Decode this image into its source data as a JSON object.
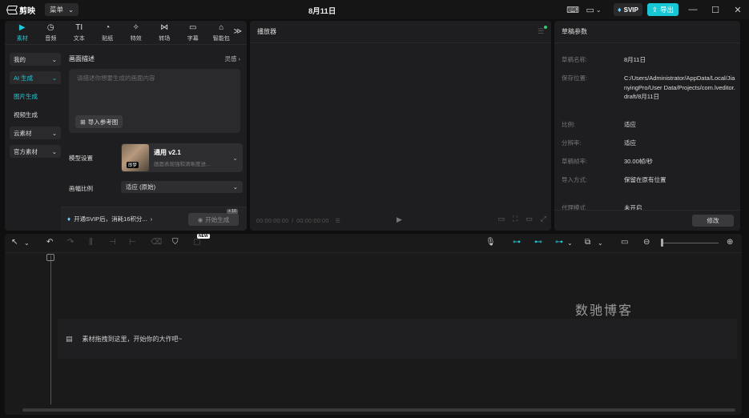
{
  "app": {
    "name": "剪映",
    "menu_label": "菜单",
    "title": "8月11日",
    "svip_label": "SVIP",
    "export_label": "导出"
  },
  "tool_tabs": [
    {
      "label": "素材",
      "icon": "media-icon",
      "active": true
    },
    {
      "label": "音频",
      "icon": "audio-icon"
    },
    {
      "label": "文本",
      "icon": "text-icon"
    },
    {
      "label": "贴纸",
      "icon": "sticker-icon"
    },
    {
      "label": "特效",
      "icon": "effects-icon"
    },
    {
      "label": "转场",
      "icon": "transition-icon"
    },
    {
      "label": "字幕",
      "icon": "subtitle-icon"
    },
    {
      "label": "智能包",
      "icon": "smart-pack-icon"
    }
  ],
  "categories": {
    "mine": "我的",
    "ai_gen": "AI 生成",
    "image_gen": "图片生成",
    "video_gen": "视频生成",
    "cloud": "云素材",
    "official": "官方素材"
  },
  "generator": {
    "heading": "画面描述",
    "inspiration": "灵感",
    "placeholder": "请描述你想要生成的画面内容",
    "ref_button": "导入参考图",
    "model_label": "模型设置",
    "model_name": "通用 v2.1",
    "model_desc": "画面表现强和清晰度进...",
    "model_tag": "即梦",
    "ratio_label": "画幅比例",
    "ratio_value": "适应 (原始)",
    "vip_text": "开通SVIP后，消耗16积分...",
    "generate_button": "开始生成",
    "generate_badge": "+ 16"
  },
  "player": {
    "title": "播放器",
    "time_current": "00:00:00:00",
    "time_total": "00:00:00:00"
  },
  "draft": {
    "title": "草稿参数",
    "rows": [
      {
        "key": "草稿名称:",
        "value": "8月11日"
      },
      {
        "key": "保存位置:",
        "value": "C:/Users/Administrator/AppData/Local/JianyingPro/User Data/Projects/com.lveditor.draft/8月11日"
      },
      {
        "key": "比例:",
        "value": "适应"
      },
      {
        "key": "分辨率:",
        "value": "适应"
      },
      {
        "key": "草稿帧率:",
        "value": "30.00帧/秒"
      },
      {
        "key": "导入方式:",
        "value": "保留在原有位置"
      },
      {
        "key": "代理模式",
        "value": "未开启"
      }
    ],
    "modify_button": "修改"
  },
  "timeline": {
    "new_badge": "NEW",
    "drop_hint": "素材拖拽到这里，开始你的大作吧~",
    "watermark": "数驰博客"
  },
  "colors": {
    "accent": "#20c9d8",
    "export": "#18c7d6",
    "panel": "#1e1e20",
    "background": "#0f0f10"
  }
}
